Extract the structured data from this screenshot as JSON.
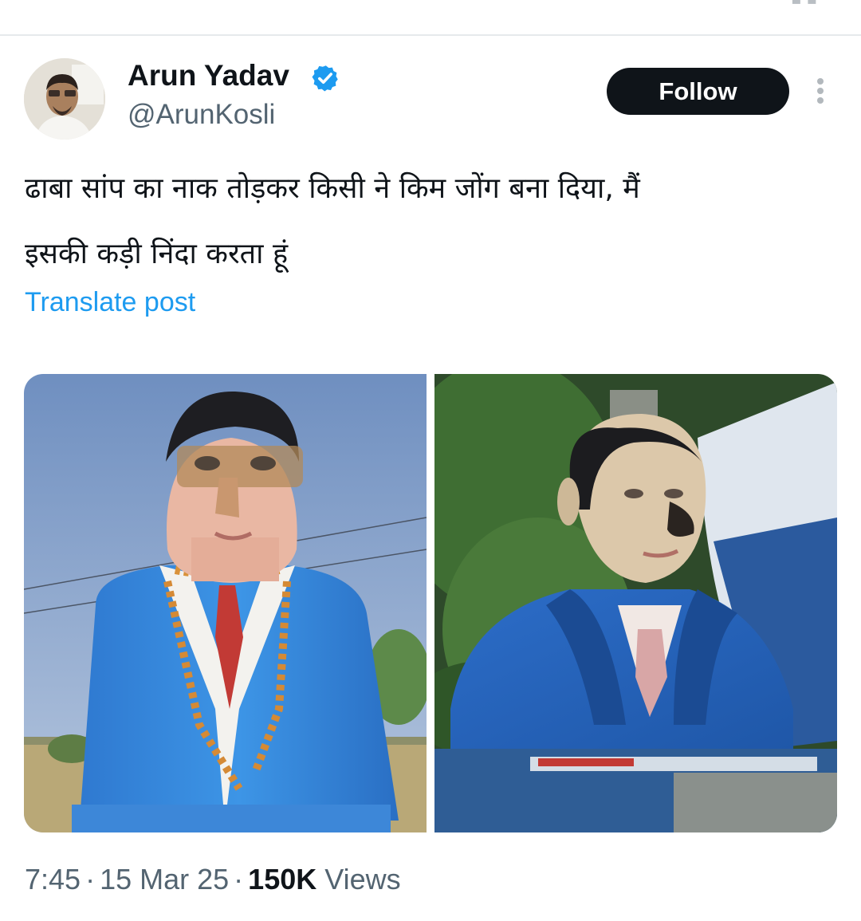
{
  "tweet": {
    "author": {
      "name": "Arun Yadav",
      "handle": "@ArunKosli",
      "verified": true
    },
    "follow_label": "Follow",
    "text": "ढाबा सांप का नाक तोड़कर किसी ने किम जोंग बना दिया, मैं\nइसकी कड़ी निंदा करता हूं",
    "translate_label": "Translate post",
    "time": "7:45",
    "date": "15 Mar 25",
    "separator": "·",
    "views_count": "150K",
    "views_label": "Views"
  },
  "colors": {
    "text": "#0f1419",
    "muted": "#536471",
    "link": "#1d9bf0",
    "verified_badge": "#1d9bf0",
    "follow_bg": "#0f1419",
    "divider": "#e6e9ec"
  },
  "icons": {
    "verified": "verified-badge-icon",
    "more": "more-vertical-icon"
  }
}
